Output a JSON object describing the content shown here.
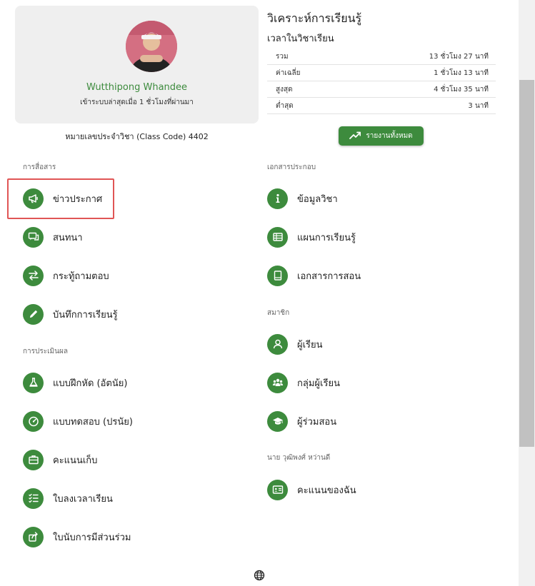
{
  "profile": {
    "name": "Wutthipong Whandee",
    "last_login": "เข้าระบบล่าสุดเมื่อ 1 ชั่วโมงที่ผ่านมา",
    "class_code": "หมายเลขประจำวิชา (Class Code) 4402"
  },
  "analysis": {
    "title": "วิเคราะห์การเรียนรู้",
    "subtitle": "เวลาในวิชาเรียน",
    "rows": [
      {
        "label": "รวม",
        "value": "13 ชั่วโมง 27 นาที"
      },
      {
        "label": "ค่าเฉลี่ย",
        "value": "1 ชั่วโมง 13 นาที"
      },
      {
        "label": "สูงสุด",
        "value": "4 ชั่วโมง 35 นาที"
      },
      {
        "label": "ต่ำสุด",
        "value": "3 นาที"
      }
    ],
    "report_button": "รายงานทั้งหมด"
  },
  "left": {
    "communication_label": "การสื่อสาร",
    "communication": [
      {
        "label": "ข่าวประกาศ",
        "icon": "megaphone-icon"
      },
      {
        "label": "สนทนา",
        "icon": "chat-icon"
      },
      {
        "label": "กระทู้ถามตอบ",
        "icon": "swap-arrows-icon"
      },
      {
        "label": "บันทึกการเรียนรู้",
        "icon": "pencil-icon"
      }
    ],
    "assessment_label": "การประเมินผล",
    "assessment": [
      {
        "label": "แบบฝึกหัด (อัตนัย)",
        "icon": "flask-icon"
      },
      {
        "label": "แบบทดสอบ (ปรนัย)",
        "icon": "gauge-icon"
      },
      {
        "label": "คะแนนเก็บ",
        "icon": "briefcase-icon"
      },
      {
        "label": "ใบลงเวลาเรียน",
        "icon": "checklist-icon"
      },
      {
        "label": "ใบนับการมีส่วนร่วม",
        "icon": "share-icon"
      }
    ]
  },
  "right": {
    "documents_label": "เอกสารประกอบ",
    "documents": [
      {
        "label": "ข้อมูลวิชา",
        "icon": "info-icon"
      },
      {
        "label": "แผนการเรียนรู้",
        "icon": "table-icon"
      },
      {
        "label": "เอกสารการสอน",
        "icon": "book-icon"
      }
    ],
    "members_label": "สมาชิก",
    "members": [
      {
        "label": "ผู้เรียน",
        "icon": "person-icon"
      },
      {
        "label": "กลุ่มผู้เรียน",
        "icon": "group-icon"
      },
      {
        "label": "ผู้ร่วมสอน",
        "icon": "graduation-cap-icon"
      }
    ],
    "me_label": "นาย วุฒิพงศ์ หว่านดี",
    "me": [
      {
        "label": "คะแนนของฉัน",
        "icon": "id-card-icon"
      }
    ]
  },
  "colors": {
    "primary": "#3d8b3d",
    "highlight": "#e05555"
  }
}
